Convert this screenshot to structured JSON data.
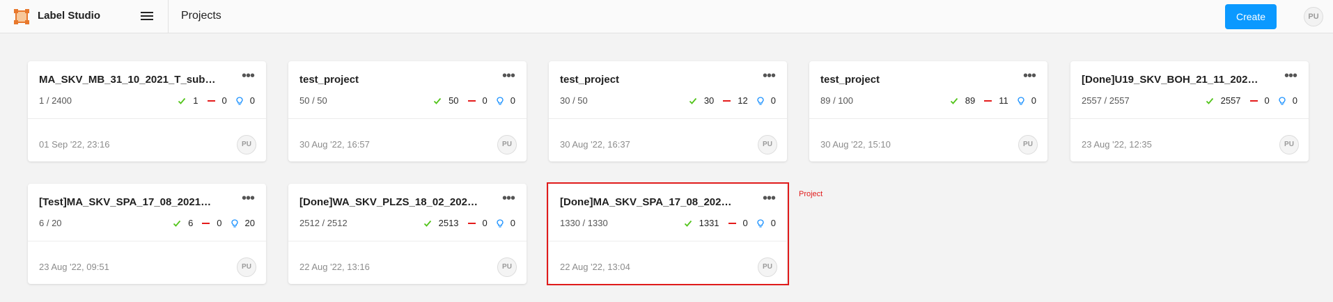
{
  "app": {
    "name": "Label Studio"
  },
  "header": {
    "breadcrumb": "Projects",
    "create_label": "Create",
    "user_initials": "PU"
  },
  "colors": {
    "accent": "#0b99ff",
    "completed": "#52c41a",
    "skipped": "#e41b1b",
    "predictions": "#1890ff",
    "annotation": "#e01b1b"
  },
  "icons": {
    "logo": "label-studio-logo-icon",
    "menu": "hamburger-menu-icon",
    "more": "more-dots-icon",
    "completed": "check-icon",
    "skipped": "minus-icon",
    "predictions": "lightbulb-icon"
  },
  "projects": [
    {
      "title": "MA_SKV_MB_31_10_2021_T_sub…",
      "progress": "1 / 2400",
      "completed": "1",
      "skipped": "0",
      "predictions": "0",
      "date": "01 Sep '22, 23:16",
      "avatar": "PU"
    },
    {
      "title": "test_project",
      "progress": "50 / 50",
      "completed": "50",
      "skipped": "0",
      "predictions": "0",
      "date": "30 Aug '22, 16:57",
      "avatar": "PU"
    },
    {
      "title": "test_project",
      "progress": "30 / 50",
      "completed": "30",
      "skipped": "12",
      "predictions": "0",
      "date": "30 Aug '22, 16:37",
      "avatar": "PU"
    },
    {
      "title": "test_project",
      "progress": "89 / 100",
      "completed": "89",
      "skipped": "11",
      "predictions": "0",
      "date": "30 Aug '22, 15:10",
      "avatar": "PU"
    },
    {
      "title": "[Done]U19_SKV_BOH_21_11_202…",
      "progress": "2557 / 2557",
      "completed": "2557",
      "skipped": "0",
      "predictions": "0",
      "date": "23 Aug '22, 12:35",
      "avatar": "PU"
    },
    {
      "title": "[Test]MA_SKV_SPA_17_08_2021…",
      "progress": "6 / 20",
      "completed": "6",
      "skipped": "0",
      "predictions": "20",
      "date": "23 Aug '22, 09:51",
      "avatar": "PU"
    },
    {
      "title": "[Done]WA_SKV_PLZS_18_02_202…",
      "progress": "2512 / 2512",
      "completed": "2513",
      "skipped": "0",
      "predictions": "0",
      "date": "22 Aug '22, 13:16",
      "avatar": "PU"
    },
    {
      "title": "[Done]MA_SKV_SPA_17_08_202…",
      "progress": "1330 / 1330",
      "completed": "1331",
      "skipped": "0",
      "predictions": "0",
      "date": "22 Aug '22, 13:04",
      "avatar": "PU"
    }
  ],
  "annotation": {
    "label": "Project"
  }
}
